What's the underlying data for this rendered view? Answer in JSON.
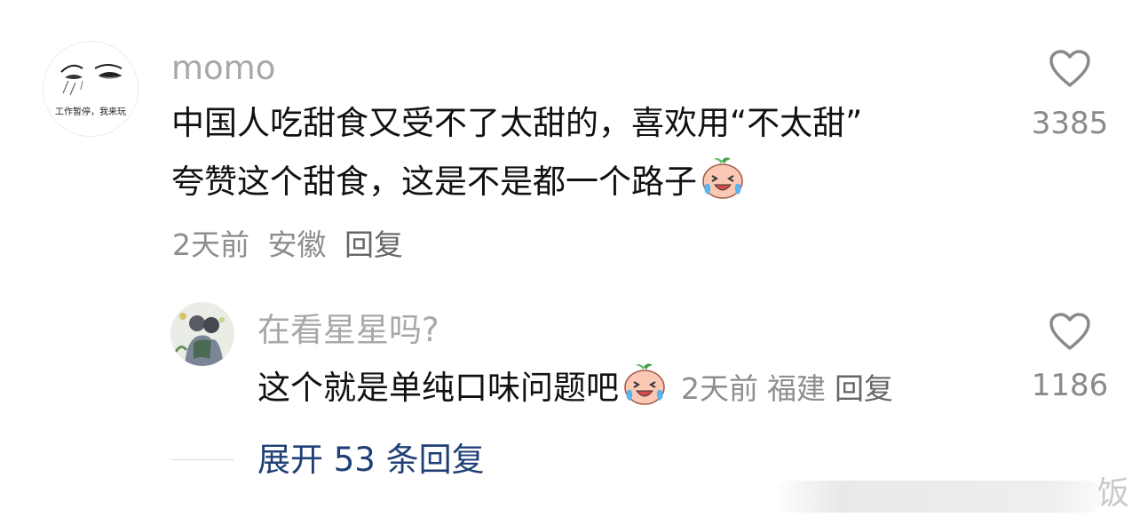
{
  "comment": {
    "username": "momo",
    "avatar_caption": "工作暂停，我来玩",
    "text_line1": "中国人吃甜食又受不了太甜的，喜欢用“不太甜”",
    "text_line2": "夸赞这个甜食，这是不是都一个路子",
    "emoji": "crying-laughing-peach-emoji",
    "time": "2天前",
    "location": "安徽",
    "reply_label": "回复",
    "like_count": "3385"
  },
  "reply": {
    "username": "在看星星吗?",
    "text": "这个就是单纯口味问题吧",
    "emoji": "crying-laughing-peach-emoji",
    "time": "2天前",
    "location": "福建",
    "reply_label": "回复",
    "like_count": "1186"
  },
  "expand": {
    "label": "展开 53 条回复"
  },
  "watermark": {
    "text": "饭"
  },
  "icons": {
    "like": "heart-outline-icon"
  },
  "colors": {
    "text": "#111111",
    "muted": "#8e8e8e",
    "username": "#a8a8a8",
    "link": "#1f3f76"
  }
}
